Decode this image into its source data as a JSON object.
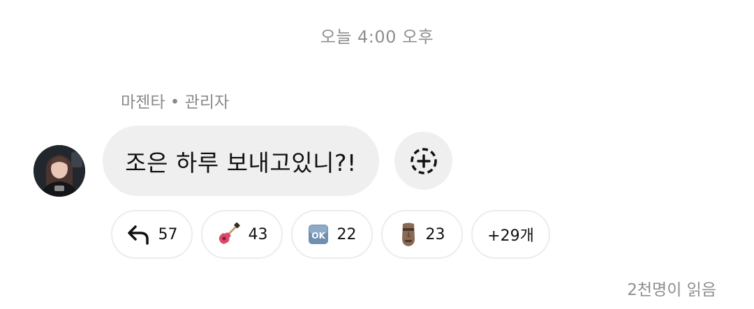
{
  "timestamp": "오늘 4:00 오후",
  "message": {
    "sender_line": "마젠타 • 관리자",
    "text": "조은 하루 보내고있니?!",
    "avatar_icon": "profile-photo",
    "add_reaction_icon": "add-reaction-icon"
  },
  "reactions": [
    {
      "icon": "reply-arrow-icon",
      "count": "57"
    },
    {
      "icon": "guitar-emoji-icon",
      "count": "43"
    },
    {
      "icon": "ok-button-emoji-icon",
      "count": "22"
    },
    {
      "icon": "moai-emoji-icon",
      "count": "23"
    }
  ],
  "more_reactions": "+29개",
  "seen_count": "2천명이 읽음",
  "colors": {
    "bubble_bg": "#efefef",
    "secondary_text": "#8e8e8e",
    "chip_border": "#ececec"
  }
}
